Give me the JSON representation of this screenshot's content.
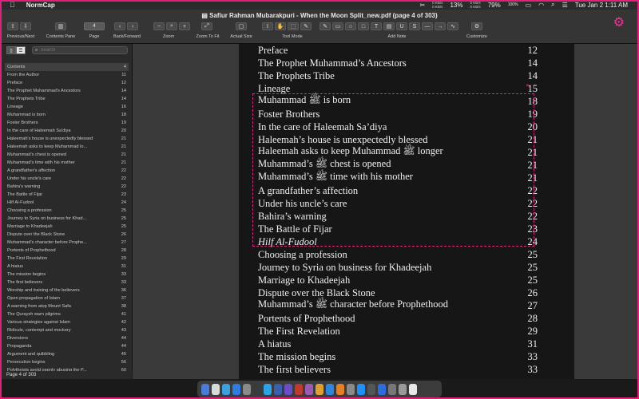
{
  "menubar": {
    "app_name": "NormCap",
    "cpu_top": "0 KB/s",
    "cpu_bottom": "0 KB/s",
    "net_top": "0 KB/s",
    "net_bottom": "0 KB/s",
    "stat1": "13%",
    "stat2": "79%",
    "battery": "100%",
    "datetime": "Tue Jan 2  1:11 AM"
  },
  "window": {
    "title": "Safiur Rahman Mubarakpuri - When the Moon Split_new.pdf (page 4 of 303)"
  },
  "toolbar": {
    "prev_next_label": "Previous/Next",
    "contents_pane_label": "Contents Pane",
    "page_label": "Page",
    "page_value": "4",
    "back_forward_label": "Back/Forward",
    "zoom_label": "Zoom",
    "zoom_to_fit_label": "Zoom To Fit",
    "actual_size_label": "Actual Size",
    "tool_mode_label": "Tool Mode",
    "add_note_label": "Add Note",
    "customize_label": "Customize",
    "accent_color": "#ff2a9d"
  },
  "sidebar": {
    "search_placeholder": "Search",
    "toc": [
      {
        "title": "Contents",
        "page": "4"
      },
      {
        "title": "From the Author",
        "page": "11"
      },
      {
        "title": "Preface",
        "page": "12"
      },
      {
        "title": "The Prophet Muhammad's Ancestors",
        "page": "14"
      },
      {
        "title": "The Prophets Tribe",
        "page": "14"
      },
      {
        "title": "Lineage",
        "page": "16"
      },
      {
        "title": "Muhammad is born",
        "page": "18"
      },
      {
        "title": "Foster Brothers",
        "page": "19"
      },
      {
        "title": "In the care of Haleemah Sa'diya",
        "page": "20"
      },
      {
        "title": "Haleemah's house is unexpectedly blessed",
        "page": "21"
      },
      {
        "title": "Haleemah asks to keep Muhammad lo...",
        "page": "21"
      },
      {
        "title": "Muhammad's chest is opened",
        "page": "21"
      },
      {
        "title": "Muhammad's time with his mother",
        "page": "21"
      },
      {
        "title": "A grandfather's affection",
        "page": "22"
      },
      {
        "title": "Under his uncle's care",
        "page": "22"
      },
      {
        "title": "Bahira's warning",
        "page": "22"
      },
      {
        "title": "The Battle of Fijar",
        "page": "23"
      },
      {
        "title": "Hilf Al-Fudool",
        "page": "24"
      },
      {
        "title": "Choosing a profession",
        "page": "25"
      },
      {
        "title": "Journey to Syria on business for Khad...",
        "page": "25"
      },
      {
        "title": "Marriage to Khadeejah",
        "page": "25"
      },
      {
        "title": "Dispute over the Black Stone",
        "page": "26"
      },
      {
        "title": "Muhammad's character before Prophe...",
        "page": "27"
      },
      {
        "title": "Portents of Prophethood",
        "page": "28"
      },
      {
        "title": "The First Revelation",
        "page": "29"
      },
      {
        "title": "A hiatus",
        "page": "31"
      },
      {
        "title": "The mission begins",
        "page": "33"
      },
      {
        "title": "The first believers",
        "page": "33"
      },
      {
        "title": "Worship and training of the believers",
        "page": "36"
      },
      {
        "title": "Open propagation of Islam",
        "page": "37"
      },
      {
        "title": "A warning from atop Mount Safa",
        "page": "38"
      },
      {
        "title": "The Quraysh warn pilgrims",
        "page": "41"
      },
      {
        "title": "Various strategies against Islam",
        "page": "42"
      },
      {
        "title": "Ridicule, contempt and mockery",
        "page": "43"
      },
      {
        "title": "Diversions",
        "page": "44"
      },
      {
        "title": "Propaganda",
        "page": "44"
      },
      {
        "title": "Argument and quibbling",
        "page": "45"
      },
      {
        "title": "Persecution begins",
        "page": "56"
      },
      {
        "title": "Polytheists avoid openly abusing the P...",
        "page": "60"
      }
    ],
    "status": "Page 4 of 303"
  },
  "document": {
    "entries": [
      {
        "title": "Preface",
        "page": "12",
        "italic": false
      },
      {
        "title": "The Prophet Muhammad’s Ancestors",
        "page": "14",
        "italic": false
      },
      {
        "title": "The Prophets Tribe",
        "page": "14",
        "italic": false
      },
      {
        "title": "Lineage",
        "page": "15",
        "italic": false
      },
      {
        "title": "Muhammad ﷺ is born",
        "page": "18",
        "italic": false
      },
      {
        "title": "Foster Brothers",
        "page": "19",
        "italic": false
      },
      {
        "title": "In the care of Haleemah Sa’diya",
        "page": "20",
        "italic": false
      },
      {
        "title": "Haleemah’s house is unexpectedly blessed",
        "page": "21",
        "italic": false
      },
      {
        "title": "Haleemah asks to keep Muhammad ﷺ longer",
        "page": "21",
        "italic": false
      },
      {
        "title": "Muhammad’s ﷺ chest is opened",
        "page": "21",
        "italic": false
      },
      {
        "title": "Muhammad’s ﷺ time with his mother",
        "page": "21",
        "italic": false
      },
      {
        "title": "A grandfather’s affection",
        "page": "22",
        "italic": false
      },
      {
        "title": "Under his uncle’s care",
        "page": "22",
        "italic": false
      },
      {
        "title": "Bahira’s warning",
        "page": "22",
        "italic": false
      },
      {
        "title": "The Battle of Fijar",
        "page": "23",
        "italic": false
      },
      {
        "title": "Hilf Al-Fudool",
        "page": "24",
        "italic": true
      },
      {
        "title": "Choosing a profession",
        "page": "25",
        "italic": false
      },
      {
        "title": "Journey to Syria on business for Khadeejah",
        "page": "25",
        "italic": false
      },
      {
        "title": "Marriage to Khadeejah",
        "page": "25",
        "italic": false
      },
      {
        "title": "Dispute over the Black Stone",
        "page": "26",
        "italic": false
      },
      {
        "title": "Muhammad’s ﷺ character before Prophethood",
        "page": "27",
        "italic": false
      },
      {
        "title": "Portents of Prophethood",
        "page": "28",
        "italic": false
      },
      {
        "title": "The First Revelation",
        "page": "29",
        "italic": false
      },
      {
        "title": "A hiatus",
        "page": "31",
        "italic": false
      },
      {
        "title": "The mission begins",
        "page": "33",
        "italic": false
      },
      {
        "title": "The first believers",
        "page": "33",
        "italic": false
      }
    ]
  }
}
